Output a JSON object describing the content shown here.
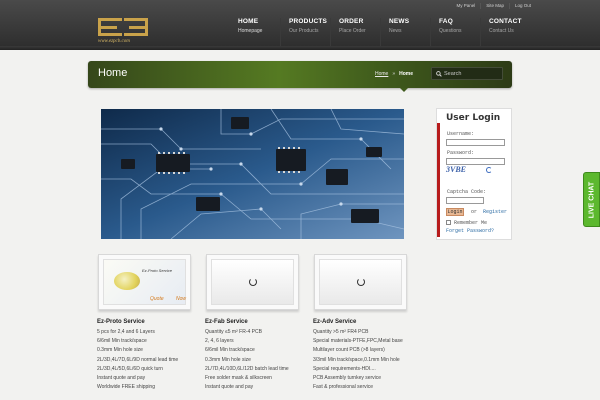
{
  "header": {
    "logo_url_text": "www.ezpcb.com",
    "top_links": [
      "My Panel",
      "Site Map",
      "Log Out"
    ],
    "nav": [
      {
        "title": "HOME",
        "sub": "Homepage"
      },
      {
        "title": "PRODUCTS",
        "sub": "Our Products"
      },
      {
        "title": "ORDER",
        "sub": "Place Order"
      },
      {
        "title": "NEWS",
        "sub": "News"
      },
      {
        "title": "FAQ",
        "sub": "Questions"
      },
      {
        "title": "CONTACT",
        "sub": "Contact Us"
      }
    ]
  },
  "banner": {
    "title": "Home",
    "breadcrumb_link": "Home",
    "breadcrumb_sep": "»",
    "breadcrumb_current": "Home",
    "search_placeholder": "Search"
  },
  "thumb1": {
    "tag": "Ez-Proto Service",
    "quote": "Quote",
    "now": "Now"
  },
  "services": [
    {
      "title": "Ez-Proto Service",
      "lines": [
        "5 pcs for 2,4 and 6 Layers",
        "6/6mil Min track/space",
        "0.3mm Min hole size",
        "2L/3D,4L/7D,6L/9D normal lead time",
        "2L/3D,4L/5D,6L/6D quick turn",
        "Instant quote and pay",
        "Worldwide FREE shipping"
      ]
    },
    {
      "title": "Ez-Fab Service",
      "lines": [
        "Quantity ≤5 m² FR-4 PCB",
        "2, 4, 6 layers",
        "6/6mil Min track/space",
        "0.3mm Min hole size",
        "2L/7D,4L/10D,6L/12D batch lead time",
        "Free solder mask & silkscreen",
        "Instant quote and pay"
      ]
    },
    {
      "title": "Ez-Adv Service",
      "lines": [
        "Quantity >5 m² FR4 PCB",
        "Special materials-PTFE,FPC,Metal base",
        "Multilayer count PCB (>8 layers)",
        "3/3mil Min track/space,0.1mm Min hole",
        "Special requirements-HDI....",
        "PCB Assembly turnkey service",
        "Fast & professional service"
      ]
    }
  ],
  "login": {
    "title": "User Login",
    "username_label": "Username:",
    "password_label": "Password:",
    "captcha_text": "3VBE",
    "captcha_code_label": "Captcha Code:",
    "login_button": "Login",
    "or_text": "or",
    "register_link": "Register",
    "remember_label": "Remember Me",
    "forgot_link": "Forget Password?"
  },
  "live_chat": "LIVE CHAT",
  "colors": {
    "banner_green": "#557a22",
    "logo_gold": "#c9a24a",
    "live_chat_green": "#5cb82e",
    "login_red": "#b71c1c"
  }
}
